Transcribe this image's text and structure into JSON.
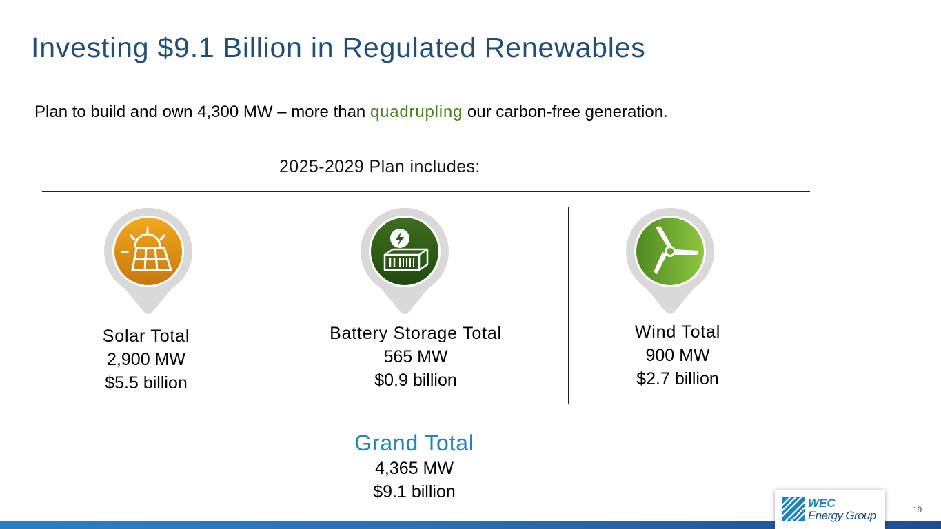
{
  "slide": {
    "title": "Investing $9.1 Billion in Regulated Renewables",
    "subtitle_before": "Plan to build and own 4,300 MW – more than ",
    "subtitle_highlight": "quadrupling",
    "subtitle_after": " our carbon-free generation.",
    "plan_heading": "2025-2029 Plan includes:",
    "page_number": "19"
  },
  "columns": [
    {
      "icon": "solar-panel-icon",
      "label": "Solar Total",
      "capacity": "2,900 MW",
      "investment": "$5.5 billion",
      "color_top": "#f2a81d",
      "color_bottom": "#c8780e"
    },
    {
      "icon": "battery-storage-icon",
      "label": "Battery Storage Total",
      "capacity": "565 MW",
      "investment": "$0.9 billion",
      "color_top": "#3e6e1f",
      "color_bottom": "#1f4a0f"
    },
    {
      "icon": "wind-turbine-icon",
      "label": "Wind Total",
      "capacity": "900 MW",
      "investment": "$2.7 billion",
      "color_top": "#8dc63f",
      "color_bottom": "#4f8a22"
    }
  ],
  "grand_total": {
    "label": "Grand Total",
    "capacity": "4,365 MW",
    "investment": "$9.1 billion"
  },
  "logo": {
    "line1": "WEC",
    "line2": "Energy Group"
  },
  "colors": {
    "title": "#1f4e79",
    "highlight": "#4a7f1d",
    "grand_total": "#1c84bf",
    "bar": "#2d6fb3"
  }
}
